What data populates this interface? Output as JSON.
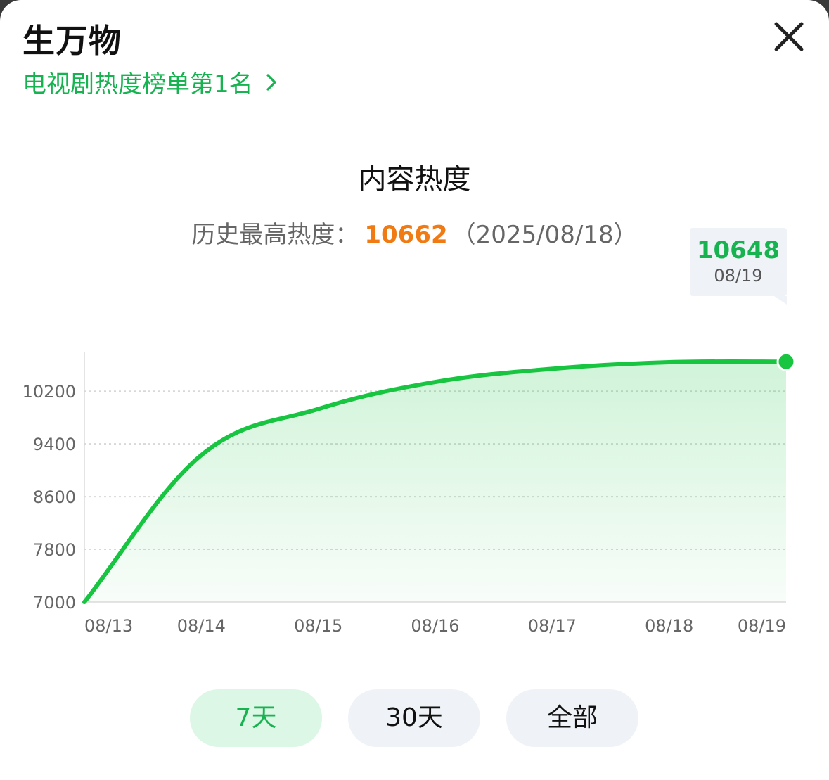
{
  "header": {
    "title": "生万物",
    "rank_link": "电视剧热度榜单第1名"
  },
  "chart_header": {
    "title": "内容热度",
    "peak_label": "历史最高热度：",
    "peak_value": "10662",
    "peak_date": "（2025/08/18）"
  },
  "tooltip": {
    "value": "10648",
    "date": "08/19"
  },
  "chart_data": {
    "type": "area",
    "x": [
      "08/13",
      "08/14",
      "08/15",
      "08/16",
      "08/17",
      "08/18",
      "08/19"
    ],
    "values": [
      7000,
      9230,
      9930,
      10340,
      10540,
      10640,
      10648
    ],
    "y_ticks": [
      7000,
      7800,
      8600,
      9400,
      10200
    ],
    "ylim": [
      7000,
      10800
    ],
    "grid": true,
    "colors": {
      "line": "#17c541",
      "fill": "#17c541",
      "grid": "#d8d8d8",
      "axis_text": "#666666"
    }
  },
  "tabs": [
    {
      "label": "7天",
      "active": true
    },
    {
      "label": "30天",
      "active": false
    },
    {
      "label": "全部",
      "active": false
    }
  ]
}
